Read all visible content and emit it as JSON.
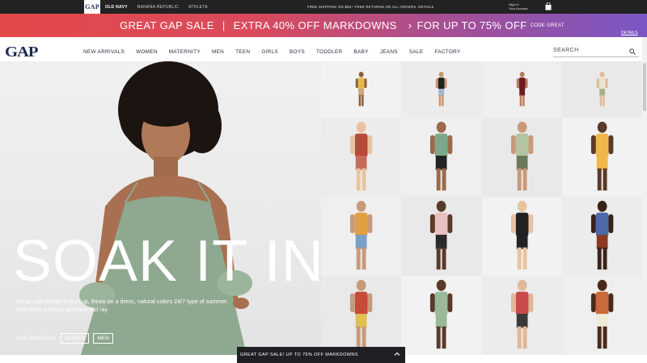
{
  "topbar": {
    "brands": [
      "GAP",
      "OLD NAVY",
      "BANANA REPUBLIC",
      "ATHLETA"
    ],
    "active_brand": "OLD NAVY",
    "shipping": "FREE SHIPPING ON $50+ FREE RETURNS ON ALL ORDERS. DETAILS",
    "signin_line1": "Sign In",
    "signin_line2": "Your Account"
  },
  "promo": {
    "part1": "GREAT GAP SALE",
    "part2": "EXTRA 40% OFF MARKDOWNS",
    "part3": "FOR UP TO 75% OFF",
    "code": "CODE GREAT",
    "details": "DETAILS",
    "colors": [
      "#e44949",
      "#a44f96",
      "#7a57c5"
    ]
  },
  "nav": {
    "logo": "GAP",
    "items": [
      "NEW ARRIVALS",
      "WOMEN",
      "MATERNITY",
      "MEN",
      "TEEN",
      "GIRLS",
      "BOYS",
      "TODDLER",
      "BABY",
      "JEANS",
      "SALE",
      "FACTORY"
    ],
    "search_placeholder": "SEARCH"
  },
  "hero": {
    "title": "SOAK IT IN",
    "subtitle_line1": "It's an unbuttoned button up, throw on a dress, natural colors 24/7 type of summer.",
    "subtitle_line2": "And we're soaking up every last ray",
    "link": "NEW ARRIVALS",
    "btn_women": "WOMEN",
    "btn_men": "MEN"
  },
  "grid": {
    "models": [
      {
        "top": "#e8b84a",
        "bottom": "#c8a87a",
        "skin": "#8a5a3c"
      },
      {
        "top": "#222222",
        "bottom": "#9fb8d0",
        "skin": "#c8946c"
      },
      {
        "top": "#6e1c22",
        "bottom": "#6e1c22",
        "skin": "#b77a58"
      },
      {
        "top": "#e8e2d0",
        "bottom": "#a8b088",
        "skin": "#e0b898"
      },
      {
        "top": "#b84a3a",
        "bottom": "#c86a5a",
        "skin": "#e8c4a0"
      },
      {
        "top": "#7aa88a",
        "bottom": "#222222",
        "skin": "#9a6a4a"
      },
      {
        "top": "#b4c4a0",
        "bottom": "#6a7a5a",
        "skin": "#c89a7a"
      },
      {
        "top": "#f0b84a",
        "bottom": "#f0b84a",
        "skin": "#5a3a28"
      },
      {
        "top": "#e0a040",
        "bottom": "#7aa0c8",
        "skin": "#c89a7a"
      },
      {
        "top": "#e8c0c0",
        "bottom": "#2a2a2a",
        "skin": "#5a3a28"
      },
      {
        "top": "#222222",
        "bottom": "#222222",
        "skin": "#e8c4a0"
      },
      {
        "top": "#4a6aa8",
        "bottom": "#8a3a22",
        "skin": "#3a2418"
      },
      {
        "top": "#c84a3a",
        "bottom": "#e0c050",
        "skin": "#c89a7a"
      },
      {
        "top": "#9ab89a",
        "bottom": "#9ab89a",
        "skin": "#5a3a28"
      },
      {
        "top": "#c84a4a",
        "bottom": "#3a3a3a",
        "skin": "#e0b898"
      },
      {
        "top": "#c86a3a",
        "bottom": "#f0ead8",
        "skin": "#4a2a1c"
      }
    ]
  },
  "drawer": {
    "label": "GREAT GAP SALE! UP TO 75% OFF MARKDOWNS"
  }
}
